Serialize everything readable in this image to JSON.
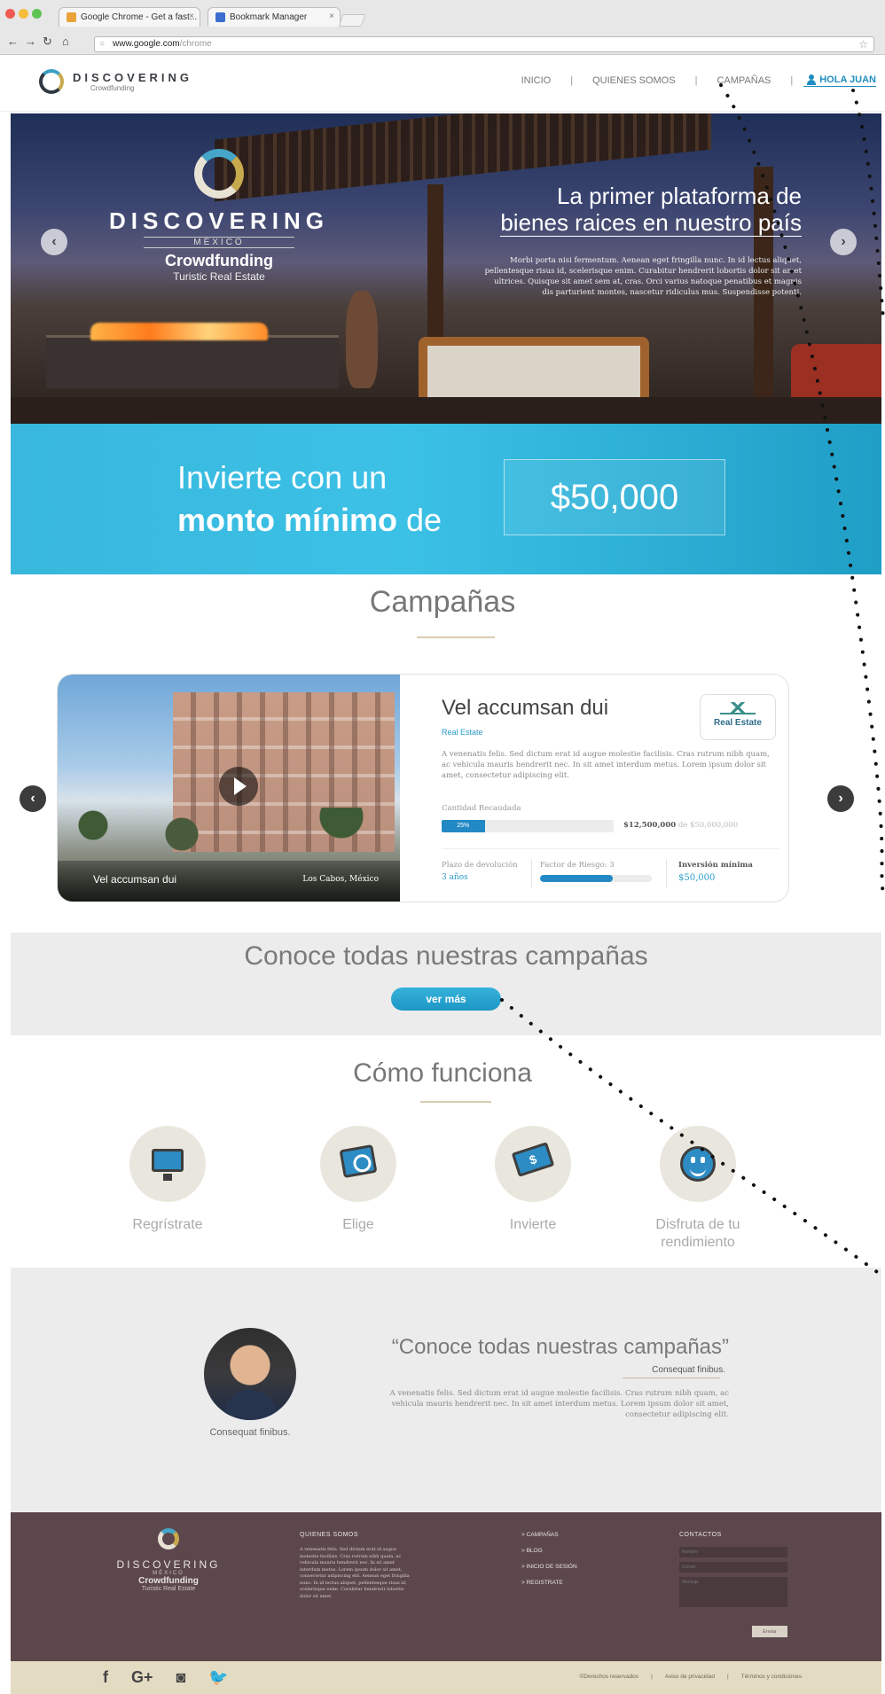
{
  "browser": {
    "tabs": [
      {
        "label": "Google Chrome - Get a fast..."
      },
      {
        "label": "Bookmark Manager"
      }
    ],
    "url_host": "www.google.com",
    "url_path": "/chrome"
  },
  "header": {
    "logo_title": "DISCOVERING",
    "logo_subtitle": "Crowdfunding",
    "menu": [
      {
        "label": "INICIO"
      },
      {
        "label": "QUIENES SOMOS"
      },
      {
        "label": "CAMPAÑAS"
      }
    ],
    "separator": "|",
    "user_label": "HOLA JUAN"
  },
  "hero": {
    "brand_title": "DISCOVERING",
    "brand_country": "MÉXICO",
    "brand_line": "Crowdfunding",
    "brand_tagline": "Turistic Real Estate",
    "title_line1": "La primer plataforma de",
    "title_line2": "bienes raices en nuestro país",
    "text": "Morbi porta nisi fermentum. Aenean eget fringilla nunc. In id lectus aliquet, pellentesque risus id, scelerisque enim. Curabitur hendrerit lobortis dolor sit amet ultrices. Quisque sit amet sem at, cras. Orci varius natoque penatibus et magnis dis parturient montes, nascetur ridiculus mus. Suspendisse potenti.",
    "prev": "‹",
    "next": "›"
  },
  "invest": {
    "line1": "Invierte con un",
    "line2_bold": "monto mínimo",
    "line2_rest": " de",
    "amount": "$50,000"
  },
  "campaigns": {
    "title": "Campañas",
    "prev": "‹",
    "next": "›",
    "card": {
      "photo_caption": "Vel accumsan dui",
      "location": "Los Cabos, México",
      "title": "Vel accumsan dui",
      "category": "Real Estate",
      "badge_label": "Real Estate",
      "description": "A venenatis felis. Sed dictum erat id augue molestie facilisis. Cras rutrum nibh quam, ac vehicula mauris hendrerit nec. In sit amet interdum metus. Lorem ipsum dolor sit amet, consectetur adipiscing elit.",
      "raised_label": "Cantidad Recaudada",
      "raised_percent_label": "25%",
      "raised_fraction": 0.25,
      "raised_amount": "$12,500,000",
      "raised_of": " de $50,000,000",
      "term_label": "Plazo de devolución",
      "term_value": "3 años",
      "risk_label": "Factor de Riesgo: 3",
      "risk_fraction": 0.65,
      "min_label": "Inversión mínima",
      "min_value": "$50,000"
    }
  },
  "all_campaigns": {
    "title": "Conoce todas nuestras campañas",
    "button": "ver más"
  },
  "how": {
    "title": "Cómo funciona",
    "steps": [
      {
        "label": "Regrístrate",
        "icon": "monitor-icon"
      },
      {
        "label": "Elige",
        "icon": "photo-icon"
      },
      {
        "label": "Invierte",
        "icon": "money-icon"
      },
      {
        "label": "Disfruta de tu rendimiento",
        "icon": "smile-icon"
      }
    ]
  },
  "testimonial": {
    "quote": "“Conoce todas nuestras campañas”",
    "author": "Consequat finibus.",
    "text": "A venenatis felis. Sed dictum erat id augue molestie facilisis. Cras rutrum nibh quam, ac vehicula mauris hendrerit nec. In sit amet interdum metus. Lorem ipsum dolor sit amet, consectetur adipiscing elit.",
    "name": "Consequat finibus."
  },
  "footer": {
    "logo_title": "DISCOVERING",
    "logo_country": "MÉXICO",
    "logo_line": "Crowdfunding",
    "logo_tagline": "Turistic Real Estate",
    "about_head": "QUIENES SOMOS",
    "about_text": "A venenatis felis. Sed dictum erat id augue molestie facilisis. Cras rutrum nibh quam, ac vehicula mauris hendrerit nec. In sit amet interdum metus. Lorem ipsum dolor sit amet, consectetur adipiscing elit. Aenean eget fringilla nunc. In id lectus aliquet, pellentesque risus id, scelerisque enim. Curabitur hendrerit lobortis dolor sit amet.",
    "links": [
      {
        "label": "> CAMPAÑAS"
      },
      {
        "label": "> BLOG"
      },
      {
        "label": "> INICIO DE SESIÓN"
      },
      {
        "label": "> REGISTRATE"
      }
    ],
    "contact_head": "CONTACTOS",
    "contact_name_placeholder": "Nombre",
    "contact_email_placeholder": "Correo",
    "contact_message_placeholder": "Mensaje",
    "send": "Enviar",
    "social": [
      "f",
      "G+",
      "◙",
      "🐦"
    ],
    "legal": [
      {
        "label": "©Derechos reservados"
      },
      {
        "label": "|"
      },
      {
        "label": "Aviso de privacidad"
      },
      {
        "label": "|"
      },
      {
        "label": "Términos y condiciones"
      }
    ]
  },
  "colors": {
    "accent": "#2a9bc9",
    "banner": "#39b7dd",
    "footer": "#5c474c",
    "bottom_bar": "#e4dcc2"
  }
}
